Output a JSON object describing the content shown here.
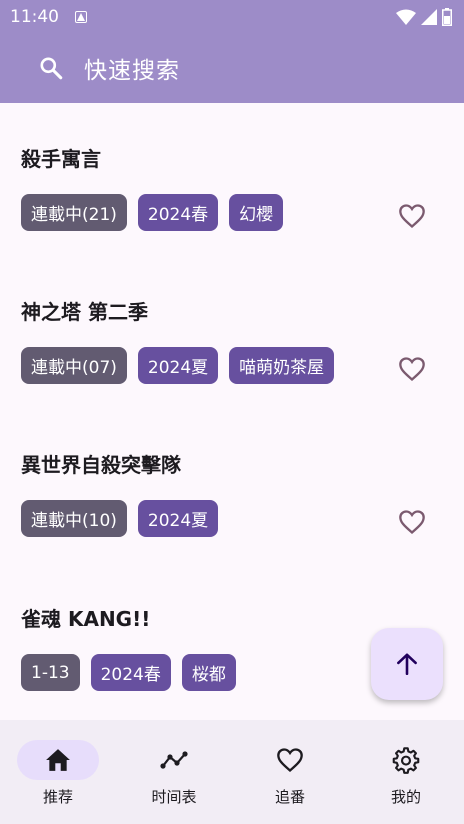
{
  "status_bar": {
    "time": "11:40"
  },
  "search": {
    "placeholder": "快速搜索"
  },
  "items": [
    {
      "title": "殺手寓言",
      "status": "連載中(21)",
      "tags": [
        "2024春",
        "幻櫻"
      ]
    },
    {
      "title": "神之塔 第二季",
      "status": "連載中(07)",
      "tags": [
        "2024夏",
        "喵萌奶茶屋"
      ]
    },
    {
      "title": "異世界自殺突擊隊",
      "status": "連載中(10)",
      "tags": [
        "2024夏"
      ]
    },
    {
      "title": "雀魂 KANG!!",
      "status": "1-13",
      "tags": [
        "2024春",
        "桜都"
      ]
    }
  ],
  "bottom_nav": [
    {
      "label": "推荐",
      "icon": "home-icon",
      "active": true
    },
    {
      "label": "时间表",
      "icon": "timeline-icon",
      "active": false
    },
    {
      "label": "追番",
      "icon": "heart-icon",
      "active": false
    },
    {
      "label": "我的",
      "icon": "gear-icon",
      "active": false
    }
  ],
  "colors": {
    "app_bar": "#9d8cc8",
    "status_chip": "#625b71",
    "tag_chip": "#67509f",
    "fab_bg": "#ebe0fd",
    "nav_bg": "#f2edf5",
    "nav_active_pill": "#e7ddfb"
  }
}
